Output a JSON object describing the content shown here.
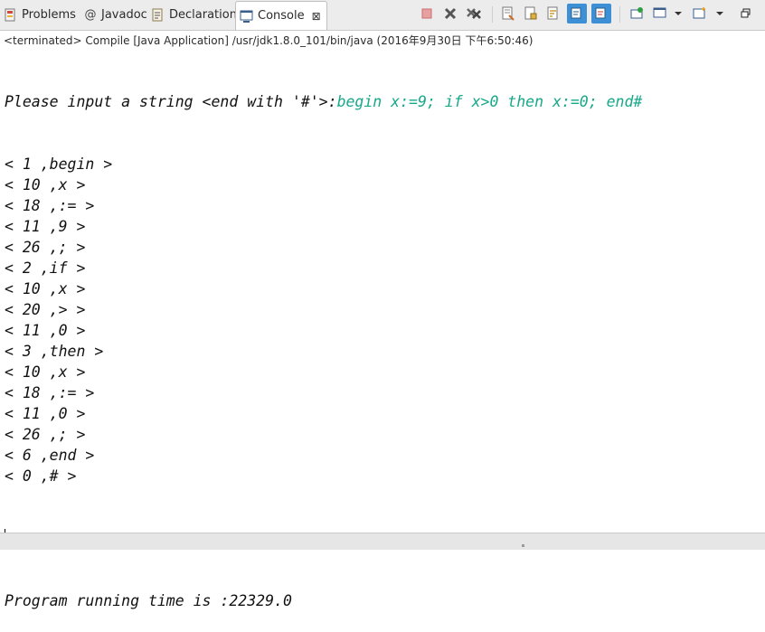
{
  "tabs": [
    {
      "label": "Problems",
      "icon": "problems-icon"
    },
    {
      "label": "Javadoc",
      "icon": "at-icon"
    },
    {
      "label": "Declaration",
      "icon": "declaration-icon"
    },
    {
      "label": "Console",
      "icon": "console-icon",
      "active": true
    }
  ],
  "toolbar": {
    "icons": [
      "terminate-icon",
      "remove-launch-icon",
      "remove-all-terminated-icon",
      "clear-console-icon",
      "scroll-lock-icon",
      "word-wrap-icon",
      "show-on-stdout-icon",
      "show-on-stderr-icon",
      "pin-console-icon",
      "display-console-icon",
      "open-console-icon",
      "minimize-icon"
    ]
  },
  "status": "<terminated> Compile [Java Application] /usr/jdk1.8.0_101/bin/java (2016年9月30日 下午6:50:46)",
  "console": {
    "prompt": "Please input a string <end with '#'>:",
    "user_input": "begin x:=9; if x>0 then x:=0; end#",
    "output_lines": [
      "< 1 ,begin >",
      "< 10 ,x >",
      "< 18 ,:= >",
      "< 11 ,9 >",
      "< 26 ,; >",
      "< 2 ,if >",
      "< 10 ,x >",
      "< 20 ,> >",
      "< 11 ,0 >",
      "< 3 ,then >",
      "< 10 ,x >",
      "< 18 ,:= >",
      "< 11 ,0 >",
      "< 26 ,; >",
      "< 6 ,end >",
      "< 0 ,# >"
    ],
    "runtime": "Program running time is :22329.0"
  }
}
